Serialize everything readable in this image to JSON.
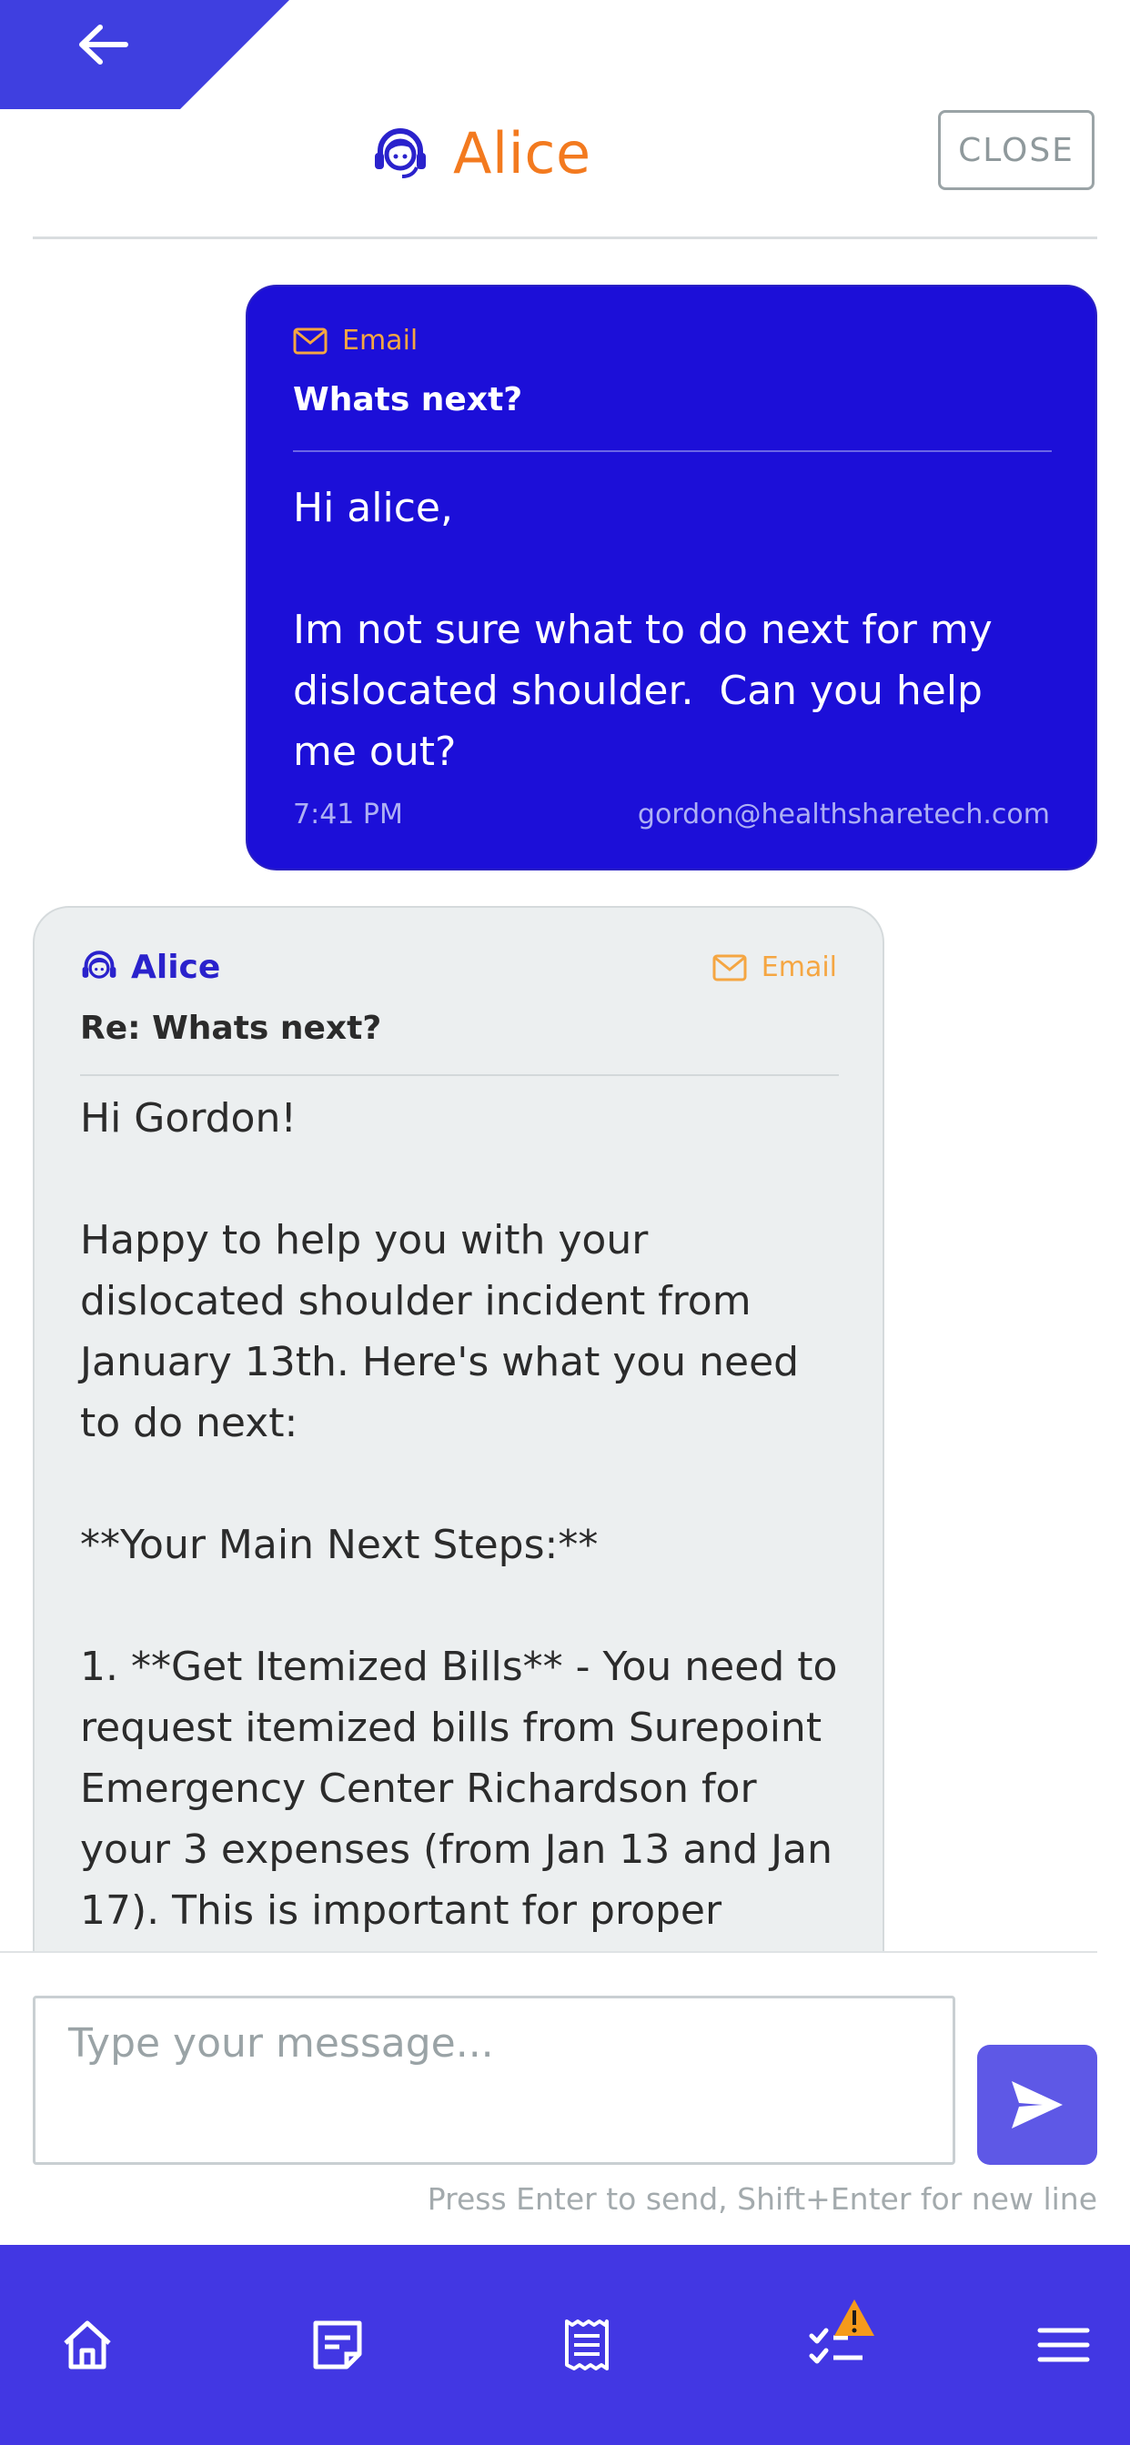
{
  "header": {
    "agent_name": "Alice",
    "close_label": "CLOSE"
  },
  "messages": {
    "outgoing": {
      "channel": "Email",
      "subject": "Whats next?",
      "body": "Hi alice,\n\nIm not sure what to do next for my dislocated shoulder.  Can you help me out?",
      "time": "7:41 PM",
      "sender": "gordon@healthsharetech.com"
    },
    "incoming": {
      "agent": "Alice",
      "channel": "Email",
      "subject": "Re: Whats next?",
      "body": "Hi Gordon!\n\nHappy to help you with your dislocated shoulder incident from January 13th. Here's what you need to do next:\n\n**Your Main Next Steps:**\n\n1. **Get Itemized Bills** - You need to request itemized bills from Surepoint Emergency Center Richardson for your 3 expenses (from Jan 13 and Jan 17). This is important for proper"
    }
  },
  "composer": {
    "placeholder": "Type your message...",
    "hint": "Press Enter to send, Shift+Enter for new line"
  },
  "colors": {
    "brand": "#4237e3",
    "outgoing_bubble": "#1c0fd8",
    "accent_orange": "#f37a1f",
    "email_tag": "#f5a642"
  },
  "nav": {
    "items": [
      "home-icon",
      "notes-icon",
      "receipt-icon",
      "tasks-icon",
      "menu-icon"
    ],
    "alert_badge": "warning-icon"
  }
}
